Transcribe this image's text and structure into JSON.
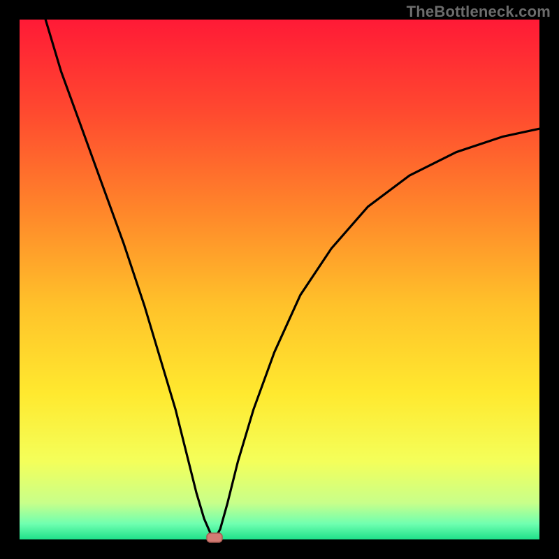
{
  "watermark": "TheBottleneck.com",
  "chart_data": {
    "type": "line",
    "title": "",
    "xlabel": "",
    "ylabel": "",
    "xlim": [
      0,
      100
    ],
    "ylim": [
      0,
      100
    ],
    "legend": false,
    "grid": false,
    "axes_visible": false,
    "background": {
      "type": "vertical-gradient",
      "stops": [
        {
          "offset": 0.0,
          "color": "#ff1a36"
        },
        {
          "offset": 0.18,
          "color": "#ff4a2f"
        },
        {
          "offset": 0.38,
          "color": "#ff8a2a"
        },
        {
          "offset": 0.55,
          "color": "#ffc22a"
        },
        {
          "offset": 0.72,
          "color": "#ffe92f"
        },
        {
          "offset": 0.85,
          "color": "#f4ff5a"
        },
        {
          "offset": 0.93,
          "color": "#c8ff8a"
        },
        {
          "offset": 0.97,
          "color": "#6fffb0"
        },
        {
          "offset": 1.0,
          "color": "#1fe08a"
        }
      ]
    },
    "series": [
      {
        "name": "bottleneck-curve",
        "color": "#000000",
        "x": [
          5,
          8,
          12,
          16,
          20,
          24,
          27,
          30,
          32,
          34,
          35.5,
          36.8,
          37.5,
          38.6,
          40,
          42,
          45,
          49,
          54,
          60,
          67,
          75,
          84,
          93,
          100
        ],
        "y": [
          100,
          90,
          79,
          68,
          57,
          45,
          35,
          25,
          17,
          9,
          4,
          1,
          0,
          2,
          7,
          15,
          25,
          36,
          47,
          56,
          64,
          70,
          74.5,
          77.5,
          79
        ]
      }
    ],
    "marker": {
      "x": 37.5,
      "y": 0,
      "shape": "rounded-rect",
      "color": "#d47b74"
    },
    "notes": "No numeric tick labels are rendered in the source image; x and y are estimated on a 0–100 normalized scale. Curve minimum (bottleneck balance point) occurs near x≈37.5."
  }
}
